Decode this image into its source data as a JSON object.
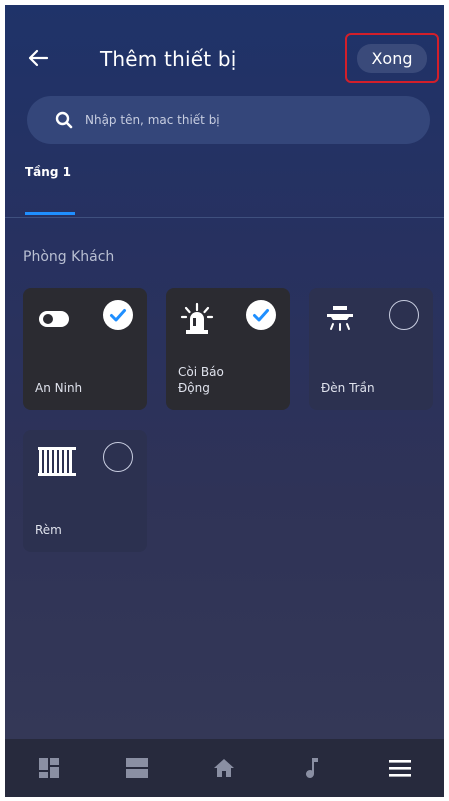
{
  "header": {
    "back_icon": "arrow-left-icon",
    "title": "Thêm thiết bị",
    "done_label": "Xong",
    "highlight_color": "#d31f2a"
  },
  "search": {
    "icon": "search-icon",
    "placeholder": "Nhập tên, mac thiết bị"
  },
  "tabs": [
    {
      "label": "Tầng 1",
      "active": true,
      "indicator_color": "#1f8fff"
    }
  ],
  "room": {
    "title": "Phòng Khách",
    "devices": [
      {
        "label": "An Ninh",
        "icon": "toggle-switch-icon",
        "selected": true
      },
      {
        "label": "Còi Báo Động",
        "icon": "siren-icon",
        "selected": true
      },
      {
        "label": "Đèn Trần",
        "icon": "ceiling-light-icon",
        "selected": false
      },
      {
        "label": "Rèm",
        "icon": "curtain-icon",
        "selected": false
      }
    ]
  },
  "bottom_nav": {
    "items": [
      {
        "icon": "dashboard-icon"
      },
      {
        "icon": "list-view-icon"
      },
      {
        "icon": "home-icon"
      },
      {
        "icon": "music-note-icon"
      },
      {
        "icon": "menu-icon"
      }
    ]
  },
  "colors": {
    "accent_check": "#1f8fff",
    "card_selected": "#2b2b31",
    "card_unselected": "#2c3150"
  }
}
